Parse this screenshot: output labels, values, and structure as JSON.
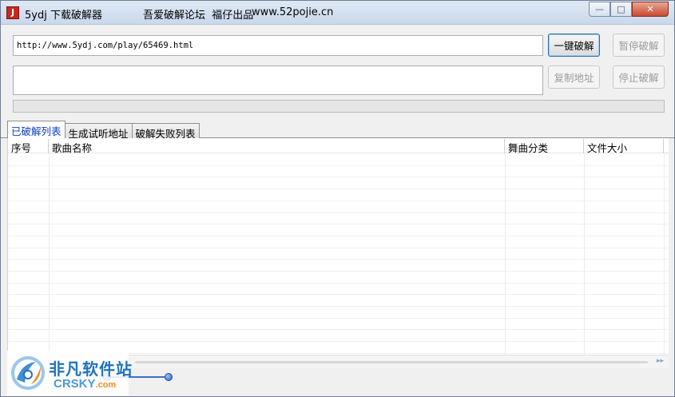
{
  "window": {
    "icon_glyph": "J",
    "title": "5ydj 下载破解器",
    "title_extra": "吾爱破解论坛  福仔出品",
    "title_site": "www.52pojie.cn",
    "controls": {
      "minimize": "—",
      "maximize": "□",
      "close": "✕"
    }
  },
  "url_input": {
    "value": "http://www.5ydj.com/play/65469.html"
  },
  "buttons": {
    "crack": "一键破解",
    "pause": "暂停破解",
    "copy": "复制地址",
    "stop": "停止破解"
  },
  "progress": {
    "percent": 0
  },
  "tabs": [
    {
      "label": "已破解列表",
      "active": true
    },
    {
      "label": "生成试听地址",
      "active": false
    },
    {
      "label": "破解失败列表",
      "active": false
    }
  ],
  "table": {
    "columns": [
      "序号",
      "歌曲名称",
      "舞曲分类",
      "文件大小"
    ],
    "rows": []
  },
  "scrollbar": {
    "arrow": "▸▸"
  },
  "watermark": {
    "cn": "非凡软件站",
    "en": "CRSKY",
    "en_suffix": ".com"
  },
  "colors": {
    "accent_tab": "#0a3ec6",
    "primary_button_border": "#2d6bb0",
    "disabled_text": "#9c9c9c"
  }
}
